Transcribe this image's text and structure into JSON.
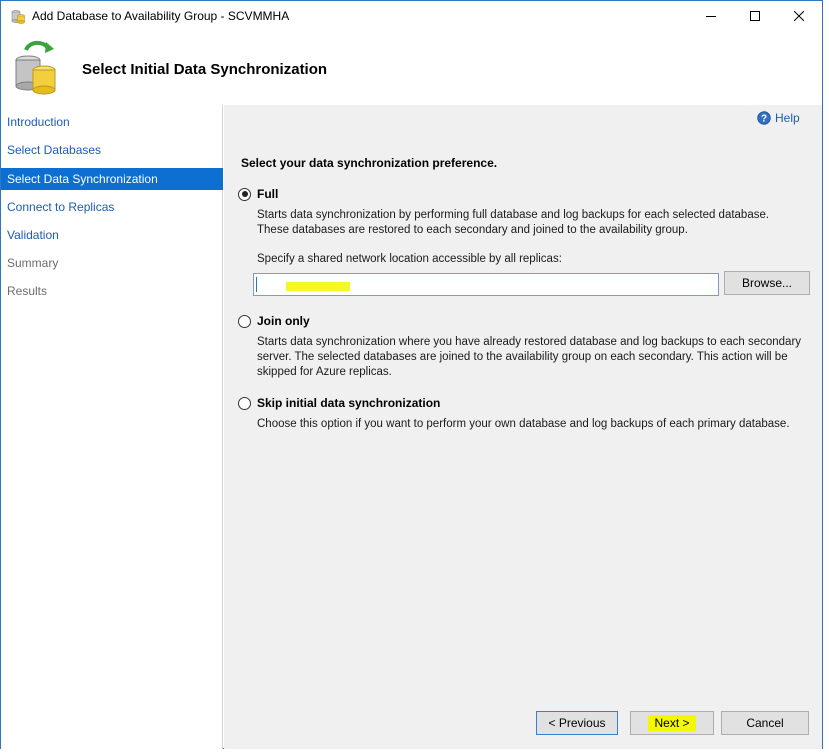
{
  "window": {
    "title": "Add Database to Availability Group - SCVMMHA",
    "controls": [
      "minimize",
      "maximize",
      "close"
    ]
  },
  "header": {
    "title": "Select Initial Data Synchronization",
    "icon": "database-sync-icon"
  },
  "sidebar": {
    "items": [
      {
        "label": "Introduction",
        "state": "link"
      },
      {
        "label": "Select Databases",
        "state": "link"
      },
      {
        "label": "Select Data Synchronization",
        "state": "active"
      },
      {
        "label": "Connect to Replicas",
        "state": "link"
      },
      {
        "label": "Validation",
        "state": "link"
      },
      {
        "label": "Summary",
        "state": "disabled"
      },
      {
        "label": "Results",
        "state": "disabled"
      }
    ]
  },
  "main": {
    "help_label": "Help",
    "prompt": "Select your data synchronization preference.",
    "options": [
      {
        "label": "Full",
        "checked": true,
        "description": "Starts data synchronization by performing full database and log backups for each selected database. These databases are restored to each secondary and joined to the availability group."
      },
      {
        "label": "Join only",
        "checked": false,
        "description": "Starts data synchronization where you have already restored database and log backups to each secondary server. The selected databases are joined to the availability group on each secondary. This action will be skipped for Azure replicas."
      },
      {
        "label": "Skip initial data synchronization",
        "checked": false,
        "description": "Choose this option if you want to perform your own database and log backups of each primary database."
      }
    ],
    "share_label": "Specify a shared network location accessible by all replicas:",
    "share_value": "",
    "browse_label": "Browse..."
  },
  "footer": {
    "previous_label": "< Previous",
    "next_label": "Next >",
    "cancel_label": "Cancel"
  },
  "colors": {
    "accent": "#0c6fd1",
    "link": "#1e5bb8",
    "pane_bg": "#f0f0f0",
    "highlight": "#f3f700"
  }
}
